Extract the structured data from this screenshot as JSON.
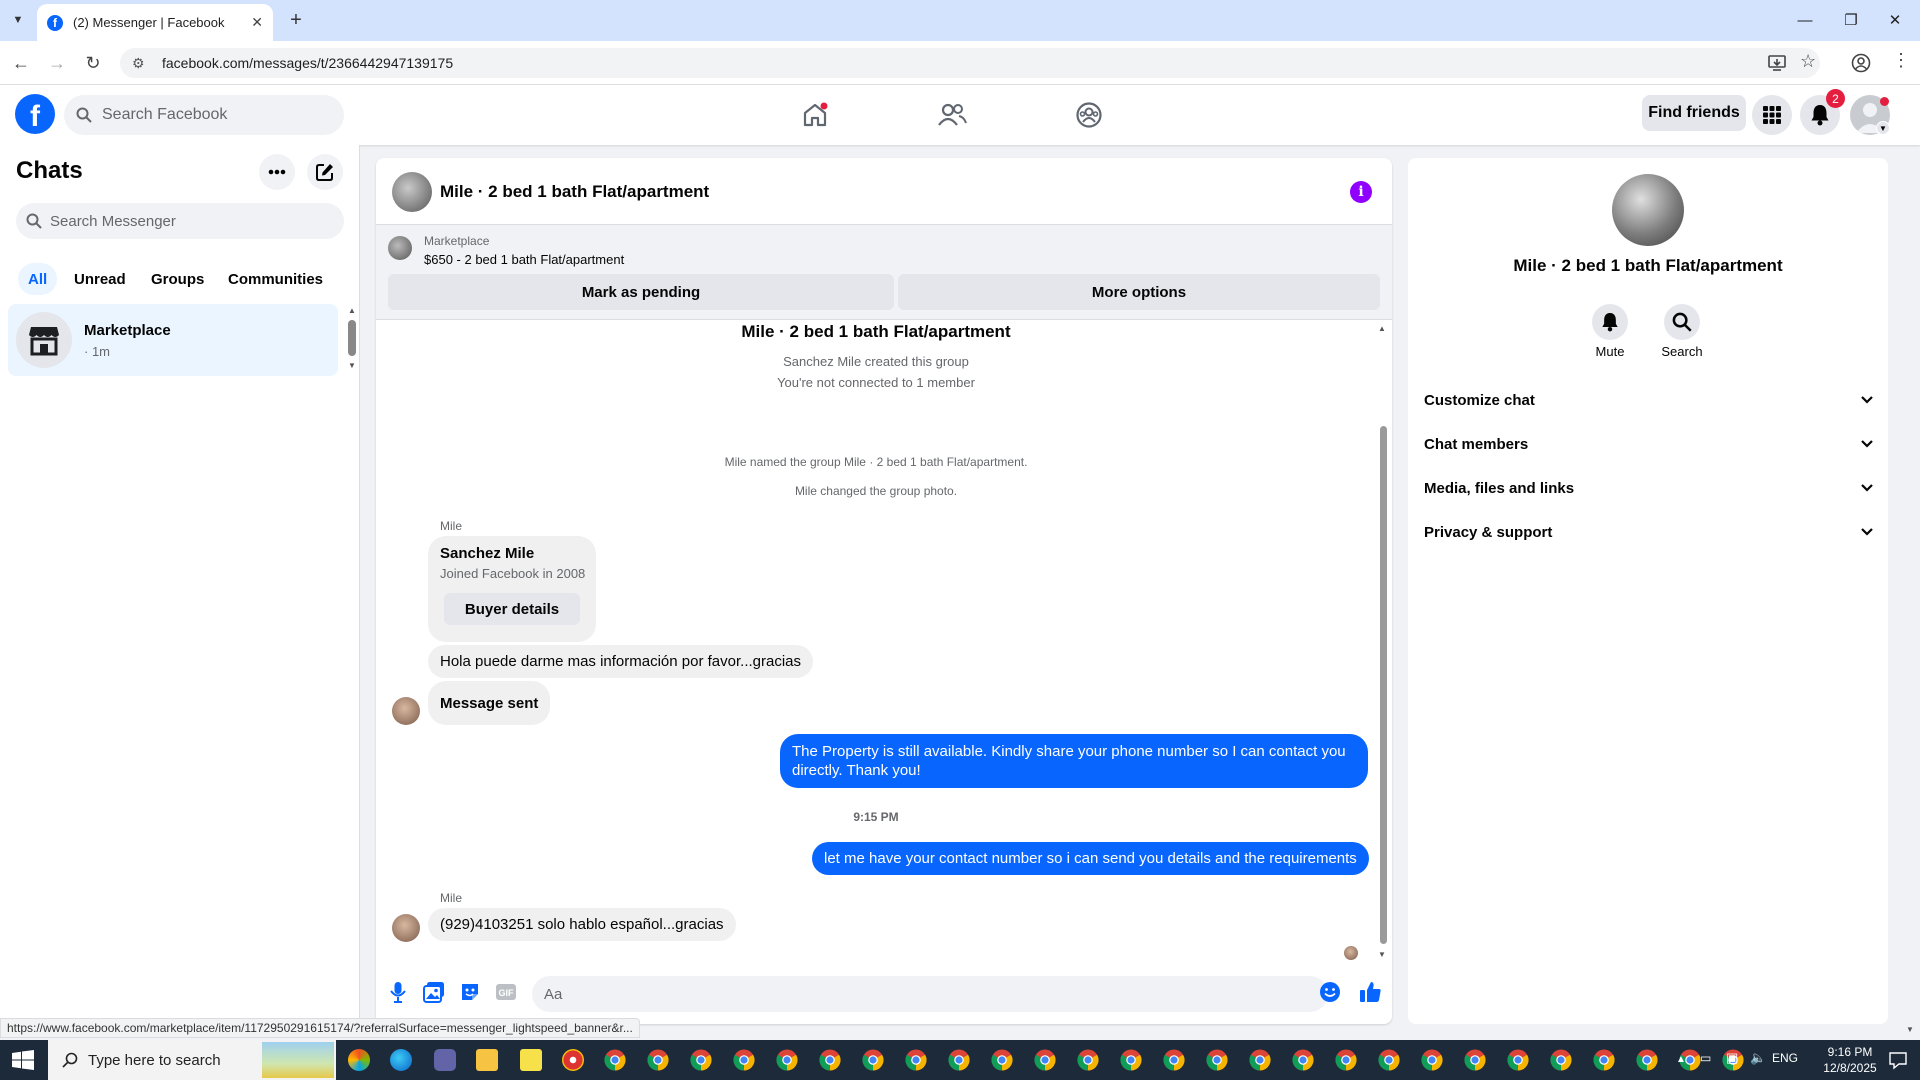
{
  "browser": {
    "tab_title": "(2) Messenger | Facebook",
    "url": "facebook.com/messages/t/2366442947139175",
    "status_url": "https://www.facebook.com/marketplace/item/1172950291615174/?referralSurface=messenger_lightspeed_banner&r..."
  },
  "fb_header": {
    "search_placeholder": "Search Facebook",
    "find_friends_label": "Find friends",
    "notification_count": "2"
  },
  "chats_panel": {
    "title": "Chats",
    "search_placeholder": "Search Messenger",
    "filters": [
      "All",
      "Unread",
      "Groups",
      "Communities"
    ],
    "items": [
      {
        "name": "Marketplace",
        "time": "· 1m"
      }
    ]
  },
  "conversation": {
    "title": "Mile · 2 bed 1 bath Flat/apartment",
    "marketplace_label": "Marketplace",
    "listing": "$650 - 2 bed 1 bath Flat/apartment",
    "mark_pending_label": "Mark as pending",
    "more_options_label": "More options",
    "group_title": "Mile · 2 bed 1 bath Flat/apartment",
    "created_text": "Sanchez Mile created this group",
    "connected_text": "You're not connected to 1 member",
    "named_text": "Mile named the group Mile · 2 bed 1 bath Flat/apartment.",
    "photo_text": "Mile changed the group photo.",
    "sender_name": "Mile",
    "card": {
      "name": "Sanchez Mile",
      "joined": "Joined Facebook in 2008",
      "button": "Buyer details"
    },
    "messages": {
      "in_1": "Hola puede darme mas información por favor...gracias",
      "in_2": "Message sent",
      "out_1": "The Property is still available. Kindly share your phone number so I can contact you directly. Thank you!",
      "timestamp": "9:15 PM",
      "out_2": "let me have your contact number so i can send you details and the requirements",
      "in_3": "(929)4103251 solo hablo español...gracias"
    },
    "composer_placeholder": "Aa"
  },
  "info_panel": {
    "name": "Mile · 2 bed 1 bath Flat/apartment",
    "mute_label": "Mute",
    "search_label": "Search",
    "sections": [
      "Customize chat",
      "Chat members",
      "Media, files and links",
      "Privacy & support"
    ]
  },
  "taskbar": {
    "search_placeholder": "Type here to search",
    "lang": "ENG",
    "time": "9:16 PM",
    "date": "12/8/2025"
  },
  "colors": {
    "fb_blue": "#0866ff",
    "info_purple": "#9000ff",
    "selected_bg": "#ebf5ff"
  }
}
